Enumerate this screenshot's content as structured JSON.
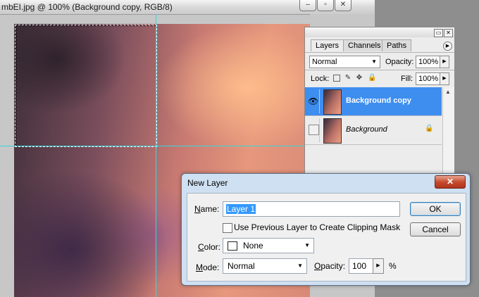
{
  "document": {
    "title": "mbEI.jpg @ 100% (Background copy, RGB/8)",
    "controls": {
      "minimize": "–",
      "maximize": "▫",
      "close": "✕"
    }
  },
  "layers_panel": {
    "tabs": [
      "Layers",
      "Channels",
      "Paths"
    ],
    "active_tab": "Layers",
    "blend_mode": "Normal",
    "opacity_label": "Opacity:",
    "opacity_value": "100%",
    "lock_label": "Lock:",
    "fill_label": "Fill:",
    "fill_value": "100%",
    "layers": [
      {
        "name": "Background copy",
        "visible": true,
        "selected": true,
        "locked": false
      },
      {
        "name": "Background",
        "visible": false,
        "selected": false,
        "locked": true
      }
    ]
  },
  "dialog": {
    "title": "New Layer",
    "name_label_prefix": "N",
    "name_label_rest": "ame:",
    "name_value": "Layer 1",
    "clip_label": "Use Previous Layer to Create Clipping Mask",
    "clip_checked": false,
    "color_label_prefix": "C",
    "color_label_rest": "olor:",
    "color_value": "None",
    "mode_label_prefix": "M",
    "mode_label_rest": "ode:",
    "mode_value": "Normal",
    "opacity_label_prefix": "O",
    "opacity_label_rest": "pacity:",
    "opacity_value": "100",
    "opacity_unit": "%",
    "ok_label": "OK",
    "cancel_label": "Cancel",
    "close_symbol": "✕"
  },
  "colors": {
    "selection_highlight": "#3e8ef0",
    "guide": "#35d7df",
    "dialog_frame": "#cfe0f2"
  }
}
